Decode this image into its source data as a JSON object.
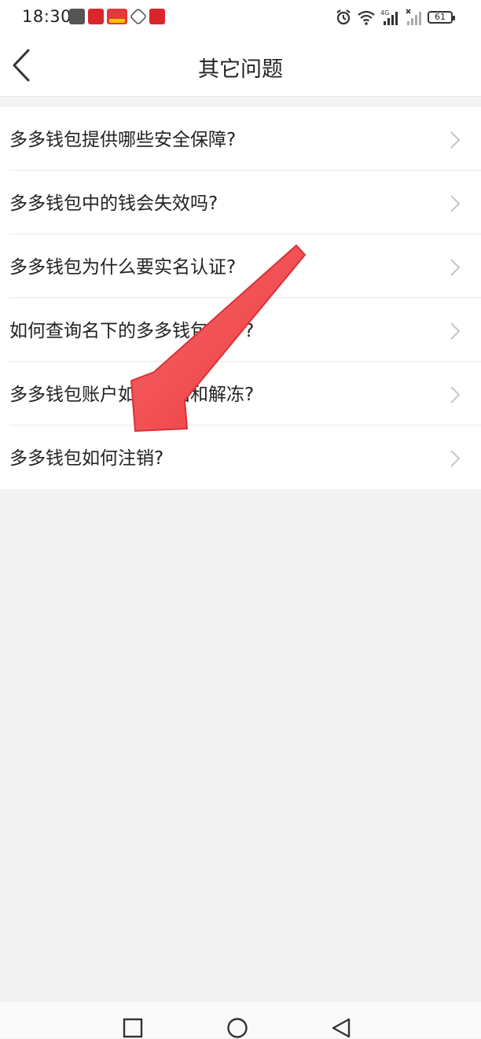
{
  "status_bar": {
    "time": "18:30",
    "battery": "61",
    "icons": [
      "alarm-icon",
      "wifi-icon",
      "signal-4g-icon",
      "signal-icon"
    ]
  },
  "header": {
    "title": "其它问题",
    "back_icon": "chevron-left-icon"
  },
  "questions": [
    {
      "label": "多多钱包提供哪些安全保障?"
    },
    {
      "label": "多多钱包中的钱会失效吗?"
    },
    {
      "label": "多多钱包为什么要实名认证?"
    },
    {
      "label": "如何查询名下的多多钱包账户?"
    },
    {
      "label": "多多钱包账户如何冻结和解冻?"
    },
    {
      "label": "多多钱包如何注销?"
    }
  ],
  "nav_bar": {
    "icons": [
      "recent-apps-icon",
      "home-icon",
      "back-triangle-icon"
    ]
  },
  "colors": {
    "background": "#f3f3f3",
    "surface": "#ffffff",
    "text": "#222222",
    "chevron": "#c6c6c6",
    "annotation_arrow": "#f04a4d"
  }
}
